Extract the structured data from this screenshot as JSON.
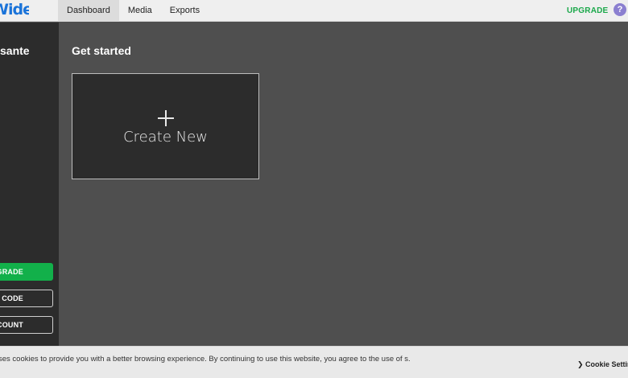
{
  "app": {
    "logo_text": "Wideo",
    "brand_color": "#1a73d9"
  },
  "nav": {
    "tabs": [
      {
        "label": "Dashboard",
        "active": true
      },
      {
        "label": "Media",
        "active": false
      },
      {
        "label": "Exports",
        "active": false
      }
    ],
    "upgrade_label": "UPGRADE",
    "upgrade_color": "#1aa84a",
    "help_label": "?",
    "help_icon": "question-icon"
  },
  "sidebar": {
    "username": "sante",
    "buttons": {
      "upgrade": "UPGRADE",
      "code": "Y CODE",
      "account": "E ACCOUNT"
    },
    "upgrade_color": "#12b04a"
  },
  "main": {
    "title": "Get started",
    "create_card": {
      "icon": "plus-icon",
      "label": "Create New"
    }
  },
  "cookie": {
    "text": "bsite uses cookies to provide you with a better browsing experience. By continuing to use this website, you agree to the use of s.",
    "settings_label": "Cookie Settin",
    "settings_icon": "chevron-right-icon"
  }
}
